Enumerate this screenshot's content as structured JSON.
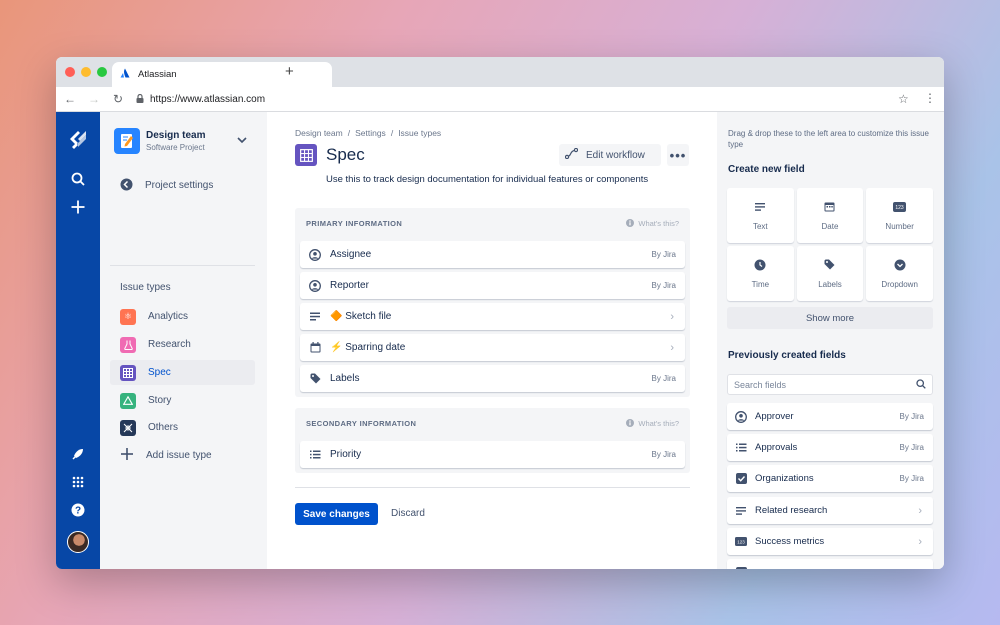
{
  "browser": {
    "tab_title": "Atlassian",
    "url": "https://www.atlassian.com",
    "new_tab": "+"
  },
  "sidebar": {
    "project_name": "Design team",
    "project_type": "Software Project",
    "settings_link": "Project settings",
    "section_heading": "Issue types",
    "items": [
      {
        "label": "Analytics",
        "color": "#ff7452"
      },
      {
        "label": "Research",
        "color": "#f06bb3"
      },
      {
        "label": "Spec",
        "color": "#6554c0"
      },
      {
        "label": "Story",
        "color": "#36b37e"
      },
      {
        "label": "Others",
        "color": "#253858"
      }
    ],
    "add_label": "Add issue type"
  },
  "main": {
    "breadcrumbs": [
      "Design team",
      "/",
      "Settings",
      "/",
      "Issue types"
    ],
    "title": "Spec",
    "edit_workflow": "Edit workflow",
    "description": "Use this to track design documentation for individual features or components",
    "primary": {
      "heading": "PRIMARY INFORMATION",
      "help": "What's this?",
      "fields": [
        {
          "label": "Assignee",
          "meta": "By Jira",
          "icon": "user-icon"
        },
        {
          "label": "Reporter",
          "meta": "By Jira",
          "icon": "user-icon"
        },
        {
          "label": "🔶 Sketch file",
          "meta": "",
          "icon": "text-lines-icon"
        },
        {
          "label": "⚡ Sparring date",
          "meta": "",
          "icon": "calendar-icon"
        },
        {
          "label": "Labels",
          "meta": "By Jira",
          "icon": "tag-icon"
        }
      ]
    },
    "secondary": {
      "heading": "SECONDARY INFORMATION",
      "help": "What's this?",
      "fields": [
        {
          "label": "Priority",
          "meta": "By Jira",
          "icon": "list-icon"
        }
      ]
    },
    "save": "Save changes",
    "discard": "Discard"
  },
  "right_panel": {
    "hint": "Drag & drop these to the left area to customize this issue type",
    "create_heading": "Create new field",
    "field_types": [
      "Text",
      "Date",
      "Number",
      "Time",
      "Labels",
      "Dropdown"
    ],
    "show_more": "Show more",
    "previous_heading": "Previously created fields",
    "search_placeholder": "Search fields",
    "previous_fields": [
      {
        "label": "Approver",
        "meta": "By Jira"
      },
      {
        "label": "Approvals",
        "meta": "By Jira"
      },
      {
        "label": "Organizations",
        "meta": "By Jira"
      },
      {
        "label": "Related research",
        "meta": ""
      },
      {
        "label": "Success metrics",
        "meta": ""
      }
    ]
  },
  "colors": {
    "global_nav": "#0747a6",
    "primary_button": "#0052cc"
  }
}
